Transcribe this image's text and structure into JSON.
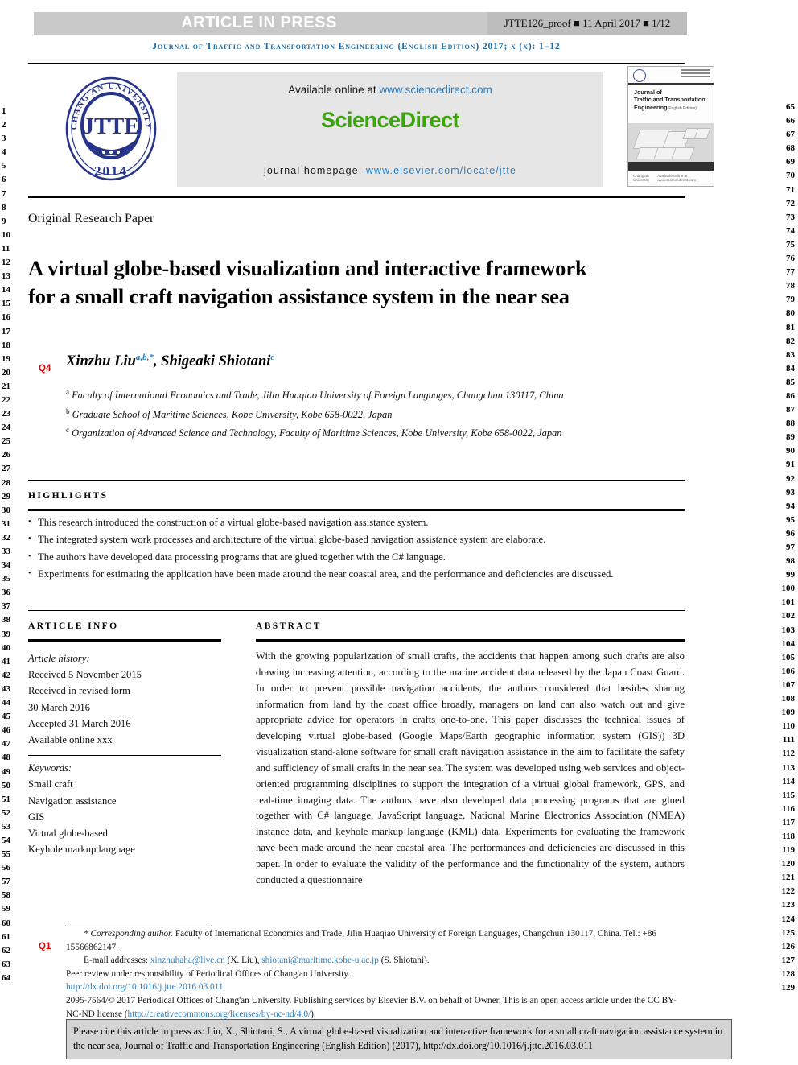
{
  "proof_header": {
    "article_in_press": "ARTICLE IN PRESS",
    "proof_info": "JTTE126_proof ■ 11 April 2017 ■ 1/12"
  },
  "journal_running_head": "Journal of Traffic and Transportation Engineering (English Edition) 2017; x (x): 1–12",
  "masthead": {
    "available_online": "Available online at",
    "sciencedirect_url": "www.sciencedirect.com",
    "sciencedirect_logo": "ScienceDirect",
    "homepage_label": "journal homepage:",
    "homepage_url": "www.elsevier.com/locate/jtte",
    "logo": {
      "outer_text": "CHANG'AN UNIVERSITY",
      "center_text": "JTTE",
      "year": "2014"
    },
    "cover": {
      "title_line1": "Journal of",
      "title_line2": "Traffic and Transportation",
      "title_line3": "Engineering",
      "title_sub": "(English Edition)",
      "foot_left": "Chang'an University",
      "foot_right": "Available online at www.sciencedirect.com"
    }
  },
  "article_type": "Original Research Paper",
  "title": "A virtual globe-based visualization and interactive framework for a small craft navigation assistance system in the near sea",
  "query_markers": {
    "q4": "Q4",
    "q1": "Q1"
  },
  "authors": {
    "author1_name": "Xinzhu Liu",
    "author1_sup": "a,b,*",
    "separator": ", ",
    "author2_name": "Shigeaki Shiotani",
    "author2_sup": "c"
  },
  "affiliations": [
    {
      "mark": "a",
      "text": "Faculty of International Economics and Trade, Jilin Huaqiao University of Foreign Languages, Changchun 130117, China"
    },
    {
      "mark": "b",
      "text": "Graduate School of Maritime Sciences, Kobe University, Kobe 658-0022, Japan"
    },
    {
      "mark": "c",
      "text": "Organization of Advanced Science and Technology, Faculty of Maritime Sciences, Kobe University, Kobe 658-0022, Japan"
    }
  ],
  "highlights": {
    "heading": "HIGHLIGHTS",
    "items": [
      "This research introduced the construction of a virtual globe-based navigation assistance system.",
      "The integrated system work processes and architecture of the virtual globe-based navigation assistance system are elaborate.",
      "The authors have developed data processing programs that are glued together with the C# language.",
      "Experiments for estimating the application have been made around the near coastal area, and the performance and deficiencies are discussed."
    ]
  },
  "article_info": {
    "heading": "ARTICLE INFO",
    "history_label": "Article history:",
    "history": [
      "Received 5 November 2015",
      "Received in revised form",
      "30 March 2016",
      "Accepted 31 March 2016",
      "Available online xxx"
    ],
    "keywords_label": "Keywords:",
    "keywords": [
      "Small craft",
      "Navigation assistance",
      "GIS",
      "Virtual globe-based",
      "Keyhole markup language"
    ]
  },
  "abstract": {
    "heading": "ABSTRACT",
    "text": "With the growing popularization of small crafts, the accidents that happen among such crafts are also drawing increasing attention, according to the marine accident data released by the Japan Coast Guard. In order to prevent possible navigation accidents, the authors considered that besides sharing information from land by the coast office broadly, managers on land can also watch out and give appropriate advice for operators in crafts one-to-one. This paper discusses the technical issues of developing virtual globe-based (Google Maps/Earth geographic information system (GIS)) 3D visualization stand-alone software for small craft navigation assistance in the aim to facilitate the safety and sufficiency of small crafts in the near sea. The system was developed using web services and object-oriented programming disciplines to support the integration of a virtual global framework, GPS, and real-time imaging data. The authors have also developed data processing programs that are glued together with C# language, JavaScript language, National Marine Electronics Association (NMEA) instance data, and keyhole markup language (KML) data. Experiments for evaluating the framework have been made around the near coastal area. The performances and deficiencies are discussed in this paper. In order to evaluate the validity of the performance and the functionality of the system, authors conducted a questionnaire"
  },
  "footnote": {
    "corresponding_label": "* Corresponding author.",
    "corresponding_text": " Faculty of International Economics and Trade, Jilin Huaqiao University of Foreign Languages, Changchun 130117, China. Tel.: +86 15566862147.",
    "email_label": "E-mail addresses:",
    "email1": "xinzhuhaha@live.cn",
    "email1_owner": "(X. Liu),",
    "email2": "shiotani@maritime.kobe-u.ac.jp",
    "email2_owner": "(S. Shiotani).",
    "peer_review": "Peer review under responsibility of Periodical Offices of Chang'an University.",
    "doi": "http://dx.doi.org/10.1016/j.jtte.2016.03.011",
    "copyright": "2095-7564/© 2017 Periodical Offices of Chang'an University. Publishing services by Elsevier B.V. on behalf of Owner. This is an open access article under the CC BY-NC-ND license (",
    "license_url": "http://creativecommons.org/licenses/by-nc-nd/4.0/",
    "copyright_end": ")."
  },
  "cite_box": {
    "text": "Please cite this article in press as: Liu, X., Shiotani, S., A virtual globe-based visualization and interactive framework for a small craft navigation assistance system in the near sea, Journal of Traffic and Transportation Engineering (English Edition) (2017), http://dx.doi.org/10.1016/j.jtte.2016.03.011"
  },
  "line_numbers": {
    "left_start": 1,
    "left_end": 64,
    "right_start": 65,
    "right_end": 129
  },
  "colors": {
    "journal_blue": "#1b6ca8",
    "link_blue": "#2b7fc4",
    "sciencedirect_green": "#3ba50b",
    "query_red": "#e00000",
    "band_gray": "#c9c9c9",
    "cite_gray": "#d4d4d4"
  }
}
